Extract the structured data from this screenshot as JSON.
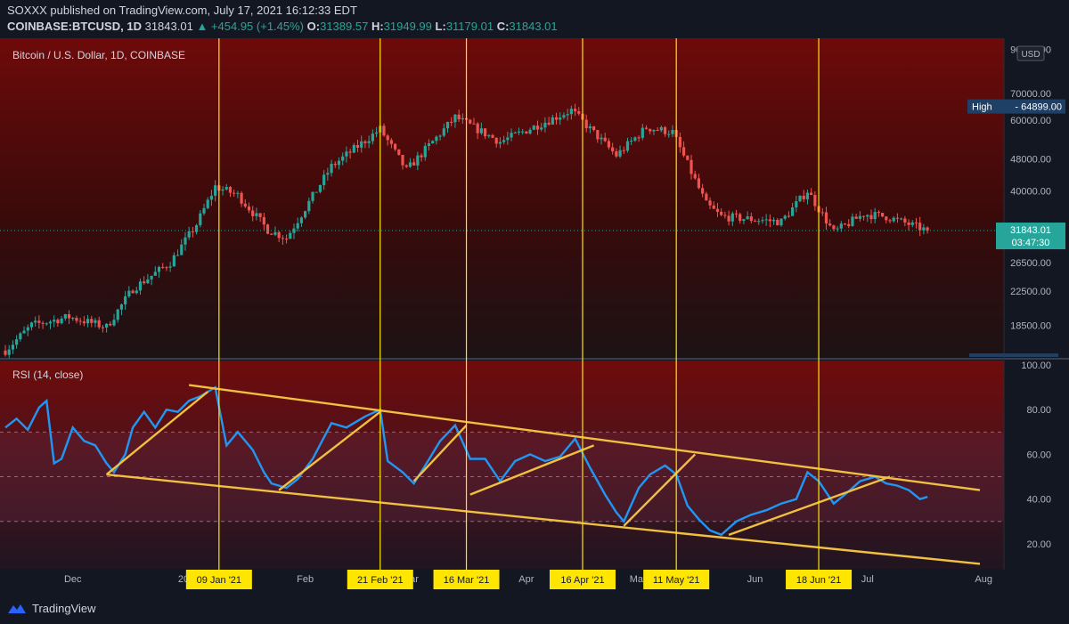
{
  "header": {
    "published": "SOXXX published on TradingView.com, July 17, 2021 16:12:33 EDT",
    "symbol": "COINBASE:BTCUSD, 1D",
    "last": "31843.01",
    "change": "▲ +454.95 (+1.45%)",
    "o_label": "O:",
    "o": "31389.57",
    "h_label": "H:",
    "h": "31949.99",
    "l_label": "L:",
    "l": "31179.01",
    "c_label": "C:",
    "c": "31843.01"
  },
  "footer": {
    "brand": "TradingView"
  },
  "colors": {
    "up": "#26a69a",
    "down": "#ef5350",
    "rsi": "#2196f3",
    "trend": "#f0c040",
    "vline": "#ffe600"
  },
  "chart_data": [
    {
      "type": "candlestick",
      "title": "Bitcoin / U.S. Dollar, 1D, COINBASE",
      "scale": "log",
      "ylim": [
        15500,
        95000
      ],
      "currency": "USD",
      "yticks": [
        "90000.00",
        "70000.00",
        "60000.00",
        "48000.00",
        "40000.00",
        "26500.00",
        "22500.00",
        "18500.00"
      ],
      "high_badge": {
        "label": "High",
        "value": "64899.00"
      },
      "last_badge": {
        "value": "31843.01",
        "countdown": "03:47:30"
      },
      "xlabels": [
        "Dec",
        "2021",
        "Feb",
        "Mar",
        "Apr",
        "May",
        "Jun",
        "Jul",
        "Aug"
      ],
      "price_points": [
        [
          "2020-11-13",
          16000
        ],
        [
          "2020-11-20",
          18500
        ],
        [
          "2020-11-30",
          19400
        ],
        [
          "2020-12-10",
          18300
        ],
        [
          "2020-12-17",
          22800
        ],
        [
          "2020-12-27",
          26500
        ],
        [
          "2021-01-03",
          33000
        ],
        [
          "2021-01-08",
          41000
        ],
        [
          "2021-01-14",
          39000
        ],
        [
          "2021-01-22",
          32000
        ],
        [
          "2021-01-27",
          30500
        ],
        [
          "2021-02-08",
          46000
        ],
        [
          "2021-02-21",
          57000
        ],
        [
          "2021-02-28",
          45000
        ],
        [
          "2021-03-13",
          61000
        ],
        [
          "2021-03-25",
          53000
        ],
        [
          "2021-04-13",
          63500
        ],
        [
          "2021-04-25",
          49000
        ],
        [
          "2021-05-03",
          57500
        ],
        [
          "2021-05-10",
          56000
        ],
        [
          "2021-05-19",
          37000
        ],
        [
          "2021-05-23",
          34500
        ],
        [
          "2021-06-08",
          33500
        ],
        [
          "2021-06-15",
          40000
        ],
        [
          "2021-06-22",
          31500
        ],
        [
          "2021-06-30",
          35000
        ],
        [
          "2021-07-06",
          34500
        ],
        [
          "2021-07-17",
          31843
        ]
      ]
    },
    {
      "type": "line",
      "title": "RSI (14, close)",
      "ylim": [
        10,
        100
      ],
      "yticks": [
        "100.00",
        "80.00",
        "60.00",
        "40.00",
        "20.00"
      ],
      "levels": [
        70,
        50,
        30
      ],
      "series": [
        {
          "values": [
            [
              "2020-11-13",
              72
            ],
            [
              "2020-11-16",
              76
            ],
            [
              "2020-11-19",
              71
            ],
            [
              "2020-11-22",
              81
            ],
            [
              "2020-11-24",
              84
            ],
            [
              "2020-11-26",
              56
            ],
            [
              "2020-11-28",
              58
            ],
            [
              "2020-12-01",
              72
            ],
            [
              "2020-12-04",
              66
            ],
            [
              "2020-12-07",
              64
            ],
            [
              "2020-12-10",
              56
            ],
            [
              "2020-12-12",
              52
            ],
            [
              "2020-12-15",
              60
            ],
            [
              "2020-12-17",
              72
            ],
            [
              "2020-12-20",
              79
            ],
            [
              "2020-12-23",
              72
            ],
            [
              "2020-12-26",
              80
            ],
            [
              "2020-12-29",
              79
            ],
            [
              "2021-01-01",
              84
            ],
            [
              "2021-01-04",
              86
            ],
            [
              "2021-01-08",
              90
            ],
            [
              "2021-01-11",
              64
            ],
            [
              "2021-01-14",
              70
            ],
            [
              "2021-01-18",
              62
            ],
            [
              "2021-01-21",
              52
            ],
            [
              "2021-01-23",
              47
            ],
            [
              "2021-01-27",
              45
            ],
            [
              "2021-01-30",
              49
            ],
            [
              "2021-02-03",
              58
            ],
            [
              "2021-02-08",
              74
            ],
            [
              "2021-02-12",
              72
            ],
            [
              "2021-02-17",
              77
            ],
            [
              "2021-02-21",
              80
            ],
            [
              "2021-02-23",
              57
            ],
            [
              "2021-02-27",
              52
            ],
            [
              "2021-03-02",
              47
            ],
            [
              "2021-03-05",
              55
            ],
            [
              "2021-03-09",
              66
            ],
            [
              "2021-03-13",
              73
            ],
            [
              "2021-03-17",
              58
            ],
            [
              "2021-03-21",
              58
            ],
            [
              "2021-03-25",
              48
            ],
            [
              "2021-03-29",
              57
            ],
            [
              "2021-04-02",
              60
            ],
            [
              "2021-04-06",
              57
            ],
            [
              "2021-04-10",
              59
            ],
            [
              "2021-04-14",
              67
            ],
            [
              "2021-04-18",
              54
            ],
            [
              "2021-04-22",
              42
            ],
            [
              "2021-04-25",
              34
            ],
            [
              "2021-04-27",
              30
            ],
            [
              "2021-05-01",
              45
            ],
            [
              "2021-05-04",
              51
            ],
            [
              "2021-05-08",
              55
            ],
            [
              "2021-05-11",
              51
            ],
            [
              "2021-05-14",
              37
            ],
            [
              "2021-05-17",
              31
            ],
            [
              "2021-05-20",
              26
            ],
            [
              "2021-05-23",
              24
            ],
            [
              "2021-05-27",
              30
            ],
            [
              "2021-05-31",
              33
            ],
            [
              "2021-06-04",
              35
            ],
            [
              "2021-06-08",
              38
            ],
            [
              "2021-06-12",
              40
            ],
            [
              "2021-06-15",
              52
            ],
            [
              "2021-06-18",
              48
            ],
            [
              "2021-06-22",
              38
            ],
            [
              "2021-06-25",
              42
            ],
            [
              "2021-06-29",
              48
            ],
            [
              "2021-07-03",
              50
            ],
            [
              "2021-07-06",
              47
            ],
            [
              "2021-07-09",
              46
            ],
            [
              "2021-07-12",
              44
            ],
            [
              "2021-07-15",
              40
            ],
            [
              "2021-07-17",
              41
            ]
          ]
        }
      ],
      "trendlines": [
        [
          "2020-12-10",
          51,
          "2021-07-31",
          11
        ],
        [
          "2021-01-01",
          91,
          "2021-07-31",
          44
        ],
        [
          "2020-12-10",
          51,
          "2021-01-06",
          88
        ],
        [
          "2021-01-25",
          44,
          "2021-02-21",
          79
        ],
        [
          "2021-03-02",
          48,
          "2021-03-16",
          73
        ],
        [
          "2021-03-17",
          42,
          "2021-04-19",
          64
        ],
        [
          "2021-04-27",
          28,
          "2021-05-16",
          60
        ],
        [
          "2021-05-25",
          24,
          "2021-07-07",
          50
        ]
      ]
    }
  ],
  "markers": [
    "09 Jan '21",
    "21 Feb '21",
    "16 Mar '21",
    "16 Apr '21",
    "11 May '21",
    "18 Jun '21"
  ],
  "marker_dates": [
    "2021-01-09",
    "2021-02-21",
    "2021-03-16",
    "2021-04-16",
    "2021-05-11",
    "2021-06-18"
  ]
}
